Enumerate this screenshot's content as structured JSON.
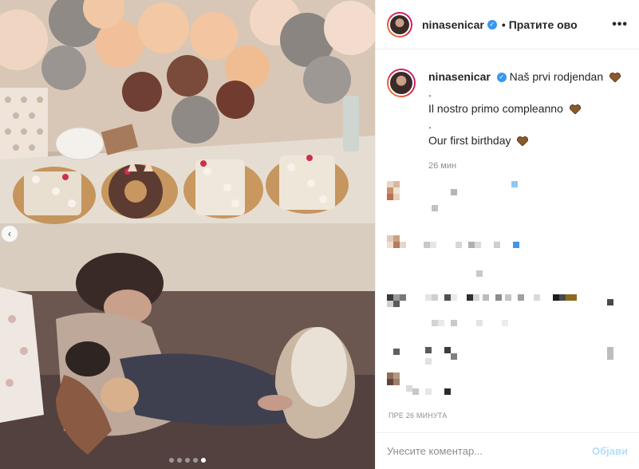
{
  "header": {
    "username": "ninasenicar",
    "separator": "•",
    "follow_label": "Пратите ово",
    "more_label": "•••"
  },
  "caption": {
    "username": "ninasenicar",
    "lines": [
      "Naš prvi rodjendan",
      ".",
      "Il nostro primo compleanno",
      ".",
      "Our first birthday"
    ],
    "heart_color": "#8b5a2b",
    "time": "26 мин"
  },
  "footer": {
    "timestamp": "ПРЕ 26 МИНУТА",
    "comment_placeholder": "Унесите коментар...",
    "post_label": "Објави"
  },
  "photo": {
    "icon": "chevron-left-icon",
    "slide_count": 5,
    "active_slide": 5,
    "cake_letters": [
      "N",
      "O",
      "R",
      "A"
    ]
  },
  "colors": {
    "verified": "#3897f0",
    "post_button": "#b2dffc",
    "secondary_text": "#8e8e8e"
  }
}
